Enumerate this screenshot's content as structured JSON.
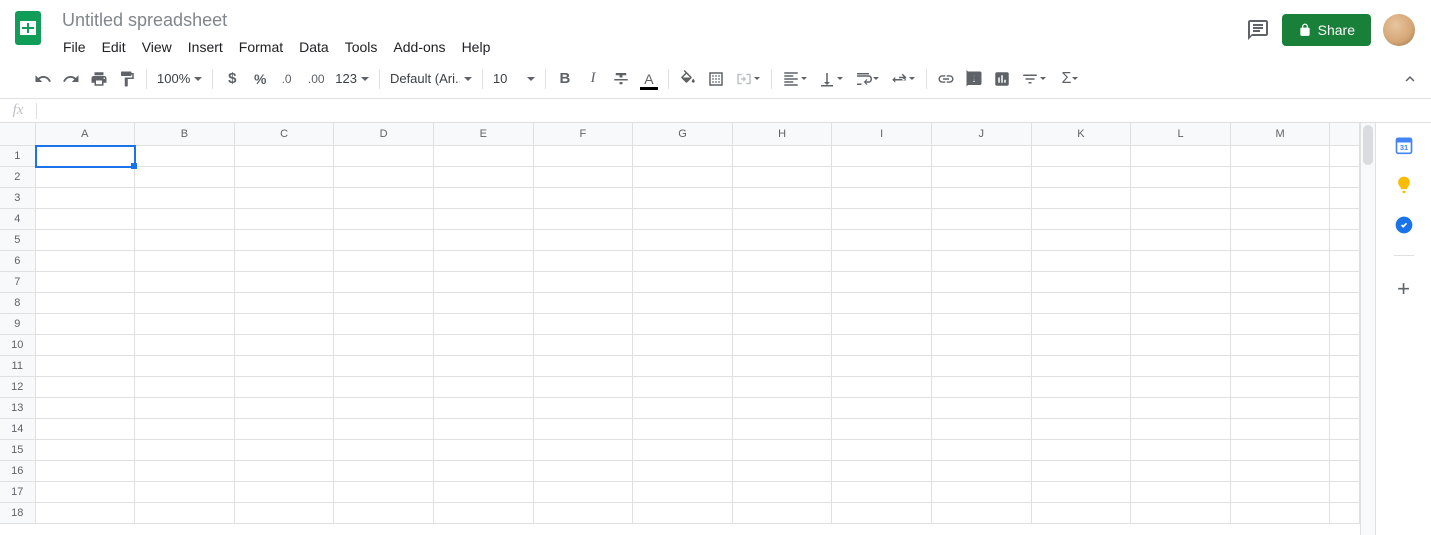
{
  "doc": {
    "title": "Untitled spreadsheet"
  },
  "menubar": [
    "File",
    "Edit",
    "View",
    "Insert",
    "Format",
    "Data",
    "Tools",
    "Add-ons",
    "Help"
  ],
  "share": {
    "label": "Share"
  },
  "toolbar": {
    "zoom": "100%",
    "font": "Default (Ari...",
    "fontSize": "10",
    "numberFormat": "123"
  },
  "fx": {
    "value": ""
  },
  "grid": {
    "columns": [
      "A",
      "B",
      "C",
      "D",
      "E",
      "F",
      "G",
      "H",
      "I",
      "J",
      "K",
      "L",
      "M"
    ],
    "rows": [
      1,
      2,
      3,
      4,
      5,
      6,
      7,
      8,
      9,
      10,
      11,
      12,
      13,
      14,
      15,
      16,
      17,
      18
    ],
    "activeCell": {
      "col": "A",
      "row": 1
    }
  }
}
